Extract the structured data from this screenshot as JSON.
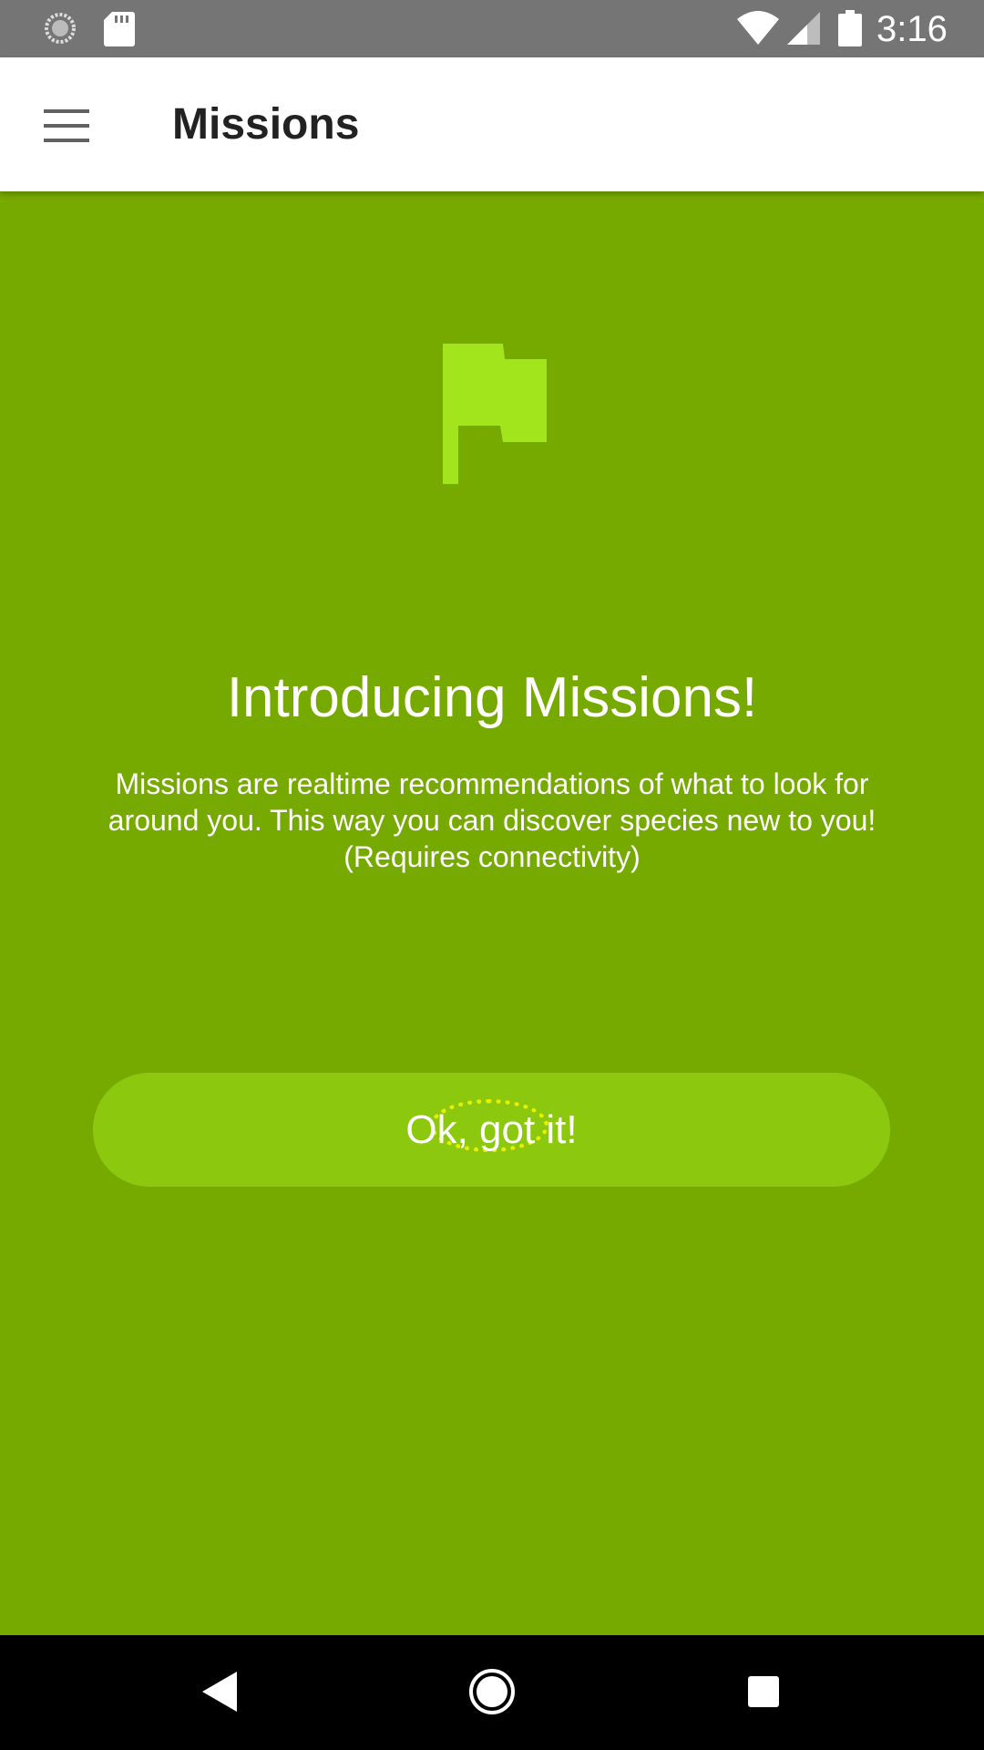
{
  "status_bar": {
    "time": "3:16",
    "icons": [
      "sync-icon",
      "sd-card-icon",
      "wifi-icon",
      "signal-icon",
      "battery-icon"
    ]
  },
  "app_bar": {
    "title": "Missions",
    "menu_icon": "hamburger-menu-icon"
  },
  "main": {
    "icon": "flag-icon",
    "title": "Introducing Missions!",
    "body": "Missions are realtime recommendations of what to look for around you. This way you can discover species new to you! (Requires connectivity)",
    "ok_button_label": "Ok, got it!"
  },
  "nav_bar": {
    "icons": [
      "back-icon",
      "home-icon",
      "recents-icon"
    ]
  },
  "colors": {
    "background": "#77aa00",
    "button": "#8cc90e",
    "flag": "#a2e51c",
    "status_bar": "#757575",
    "app_bar": "#ffffff",
    "tap_indicator": "#e8f000"
  }
}
